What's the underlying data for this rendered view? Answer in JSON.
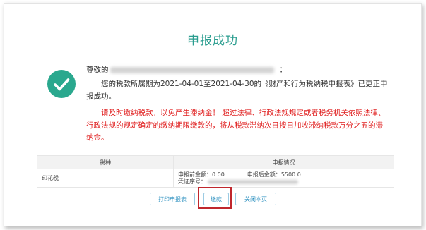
{
  "dialog": {
    "title": "申报成功",
    "greeting": "尊敬的",
    "greeting_colon": "：",
    "info": "您的税款所属期为2021-04-01至2021-04-30的《财产和行为税纳税申报表》已更正申报成功。",
    "warning": "请及时缴纳税款，以免产生滞纳金！ 超过法律、行政法规规定或者税务机关依照法律、行政法规的规定确定的缴纳期限缴款的，将从税款滞纳次日按日加收滞纳税款万分之五的滞纳金。"
  },
  "table": {
    "headers": {
      "kind": "税种",
      "status": "申报情况"
    },
    "rows": [
      {
        "kind": "印花税",
        "before_label": "申报前金额：",
        "before_value": "0.00",
        "after_label": "申报后金额：",
        "after_value": "5500.0",
        "serial_label": "凭证序号："
      }
    ]
  },
  "buttons": {
    "print": "打印申报表",
    "pay": "缴款",
    "close": "关闭本页"
  },
  "colors": {
    "accent": "#2aa88e",
    "warning": "#e02020",
    "highlight": "#c0272d"
  },
  "icons": {
    "status": "check-icon"
  }
}
